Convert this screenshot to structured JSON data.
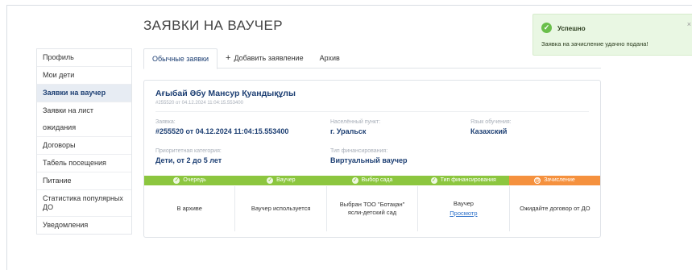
{
  "page_title": "ЗАЯВКИ НА ВАУЧЕР",
  "sidebar": {
    "items": [
      {
        "label": "Профиль"
      },
      {
        "label": "Мои дети"
      },
      {
        "label": "Заявки на ваучер",
        "active": true
      },
      {
        "label": "Заявки на лист ожидания"
      },
      {
        "label": "Договоры"
      },
      {
        "label": "Табель посещения"
      },
      {
        "label": "Питание"
      },
      {
        "label": "Статистика популярных ДО"
      },
      {
        "label": "Уведомления"
      }
    ]
  },
  "tabs": {
    "regular": "Обычные заявки",
    "add": "Добавить заявление",
    "add_icon": "+",
    "archive": "Архив"
  },
  "card": {
    "name": "Ағыбай Әбу Мансур Қуандықұлы",
    "subline": "#255520 от 04.12.2024 11:04:15.553400",
    "application_label": "Заявка:",
    "application_value": "#255520 от 04.12.2024 11:04:15.553400",
    "locality_label": "Населённый пункт:",
    "locality_value": "г. Уральск",
    "language_label": "Язык обучения:",
    "language_value": "Казахский",
    "priority_label": "Приоритетная категория:",
    "priority_value": "Дети, от 2 до 5 лет",
    "financing_label": "Тип финансирования:",
    "financing_value": "Виртуальный ваучер"
  },
  "steps": [
    {
      "label": "Очередь",
      "state": "done"
    },
    {
      "label": "Ваучер",
      "state": "done"
    },
    {
      "label": "Выбор сада",
      "state": "done"
    },
    {
      "label": "Тип финансирования",
      "state": "done"
    },
    {
      "label": "Зачисление",
      "state": "current"
    }
  ],
  "statuses": {
    "queue": "В архиве",
    "voucher": "Ваучер используется",
    "kindergarten": "Выбран ТОО \"Ботақан\" ясли-детский сад",
    "financing_title": "Ваучер",
    "financing_link": "Просмотр",
    "enrollment": "Ожидайте договор от ДО"
  },
  "toast": {
    "title": "Успешно",
    "message": "Заявка на зачисление удачно подана!",
    "close": "×"
  },
  "colors": {
    "step_done": "#8cc63f",
    "step_current": "#f5913e",
    "accent_text": "#1d3f73",
    "toast_bg": "#e9f7e3",
    "toast_icon": "#6abf4b"
  },
  "icons": {
    "step_done": "check-circle-icon",
    "step_current": "clock-icon",
    "toast": "check-circle-icon",
    "close": "close-icon"
  }
}
